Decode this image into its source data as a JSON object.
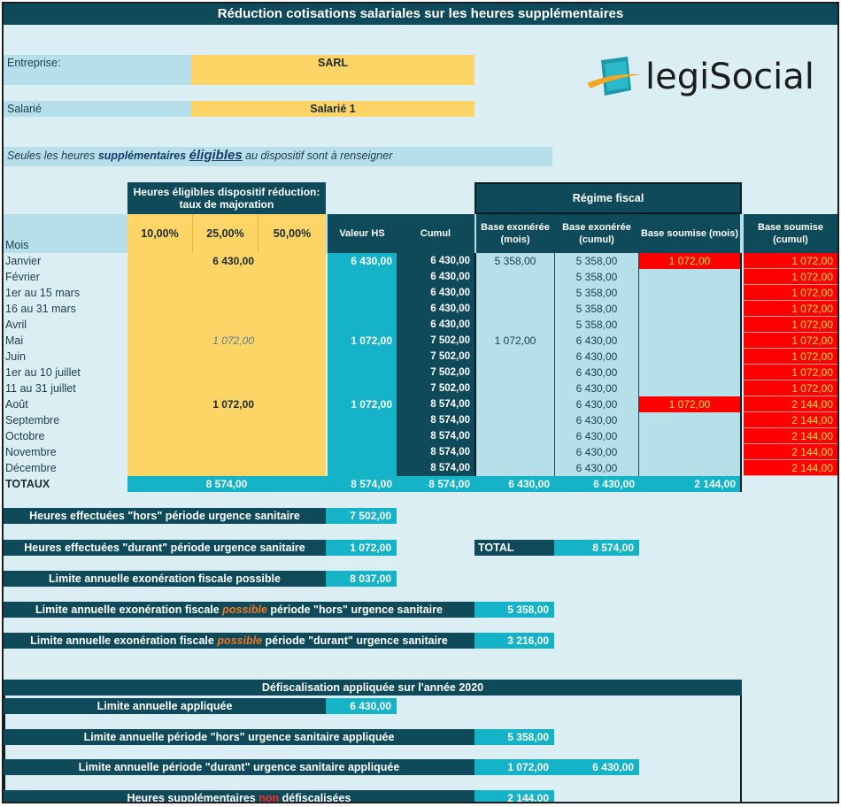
{
  "title": "Réduction cotisations salariales sur les heures supplémentaires",
  "logo": {
    "part1": "legi",
    "part2": "Social",
    "icon": "legisocial-logo-icon",
    "color_accent": "#f5a623",
    "color_main": "#1c1c1c",
    "color_cube": "#1a9aaa"
  },
  "entreprise": {
    "label": "Entreprise:",
    "value": "SARL"
  },
  "salarie": {
    "label": "Salarié",
    "value": "Salarié 1"
  },
  "note": {
    "part1": "Seules les heures ",
    "part2": "supplémentaires",
    "part3": "éligibles",
    "part4": " au dispositif sont à renseigner"
  },
  "table": {
    "group_header": "Heures éligibles dispositif réduction: taux de majoration",
    "rates": [
      "10,00%",
      "25,00%",
      "50,00%"
    ],
    "valeur_hs": "Valeur HS",
    "cumul": "Cumul",
    "regime_fiscal": "Régime fiscal",
    "base_exo_mois": "Base exonérée (mois)",
    "base_exo_cumul": "Base exonérée (cumul)",
    "base_soumise_mois": "Base soumise (mois)",
    "base_soumise_cumul": "Base soumise (cumul)",
    "mois_label": "Mois",
    "rows": [
      {
        "mois": "Janvier",
        "r25": "6 430,00",
        "r25_italic": false,
        "valeur": "6 430,00",
        "cumul": "6 430,00",
        "exo_mois": "5 358,00",
        "exo_cumul": "5 358,00",
        "soum_mois": "1 072,00",
        "soum_cumul": "1 072,00"
      },
      {
        "mois": "Février",
        "r25": "",
        "r25_italic": false,
        "valeur": "",
        "cumul": "6 430,00",
        "exo_mois": "",
        "exo_cumul": "5 358,00",
        "soum_mois": "",
        "soum_cumul": "1 072,00"
      },
      {
        "mois": "1er au 15 mars",
        "r25": "",
        "r25_italic": false,
        "valeur": "",
        "cumul": "6 430,00",
        "exo_mois": "",
        "exo_cumul": "5 358,00",
        "soum_mois": "",
        "soum_cumul": "1 072,00"
      },
      {
        "mois": "16 au 31 mars",
        "r25": "",
        "r25_italic": false,
        "valeur": "",
        "cumul": "6 430,00",
        "exo_mois": "",
        "exo_cumul": "5 358,00",
        "soum_mois": "",
        "soum_cumul": "1 072,00"
      },
      {
        "mois": "Avril",
        "r25": "",
        "r25_italic": false,
        "valeur": "",
        "cumul": "6 430,00",
        "exo_mois": "",
        "exo_cumul": "5 358,00",
        "soum_mois": "",
        "soum_cumul": "1 072,00"
      },
      {
        "mois": "Mai",
        "r25": "1 072,00",
        "r25_italic": true,
        "valeur": "1 072,00",
        "cumul": "7 502,00",
        "exo_mois": "1 072,00",
        "exo_cumul": "6 430,00",
        "soum_mois": "",
        "soum_cumul": "1 072,00"
      },
      {
        "mois": "Juin",
        "r25": "",
        "r25_italic": false,
        "valeur": "",
        "cumul": "7 502,00",
        "exo_mois": "",
        "exo_cumul": "6 430,00",
        "soum_mois": "",
        "soum_cumul": "1 072,00"
      },
      {
        "mois": "1er au 10 juillet",
        "r25": "",
        "r25_italic": false,
        "valeur": "",
        "cumul": "7 502,00",
        "exo_mois": "",
        "exo_cumul": "6 430,00",
        "soum_mois": "",
        "soum_cumul": "1 072,00"
      },
      {
        "mois": "11 au 31 juillet",
        "r25": "",
        "r25_italic": false,
        "valeur": "",
        "cumul": "7 502,00",
        "exo_mois": "",
        "exo_cumul": "6 430,00",
        "soum_mois": "",
        "soum_cumul": "1 072,00"
      },
      {
        "mois": "Août",
        "r25": "1 072,00",
        "r25_italic": false,
        "valeur": "1 072,00",
        "cumul": "8 574,00",
        "exo_mois": "",
        "exo_cumul": "6 430,00",
        "soum_mois": "1 072,00",
        "soum_cumul": "2 144,00"
      },
      {
        "mois": "Septembre",
        "r25": "",
        "r25_italic": false,
        "valeur": "",
        "cumul": "8 574,00",
        "exo_mois": "",
        "exo_cumul": "6 430,00",
        "soum_mois": "",
        "soum_cumul": "2 144,00"
      },
      {
        "mois": "Octobre",
        "r25": "",
        "r25_italic": false,
        "valeur": "",
        "cumul": "8 574,00",
        "exo_mois": "",
        "exo_cumul": "6 430,00",
        "soum_mois": "",
        "soum_cumul": "2 144,00"
      },
      {
        "mois": "Novembre",
        "r25": "",
        "r25_italic": false,
        "valeur": "",
        "cumul": "8 574,00",
        "exo_mois": "",
        "exo_cumul": "6 430,00",
        "soum_mois": "",
        "soum_cumul": "2 144,00"
      },
      {
        "mois": "Décembre",
        "r25": "",
        "r25_italic": false,
        "valeur": "",
        "cumul": "8 574,00",
        "exo_mois": "",
        "exo_cumul": "6 430,00",
        "soum_mois": "",
        "soum_cumul": "2 144,00"
      }
    ],
    "totaux": {
      "label": "TOTAUX",
      "r25": "8 574,00",
      "valeur": "8 574,00",
      "cumul": "8 574,00",
      "exo_mois": "6 430,00",
      "exo_cumul": "6 430,00",
      "soum_mois": "2 144,00"
    }
  },
  "summary": {
    "hors": {
      "label": "Heures effectuées \"hors\" période urgence sanitaire",
      "value": "7 502,00"
    },
    "durant": {
      "label": "Heures effectuées \"durant\" période urgence sanitaire",
      "value": "1 072,00"
    },
    "total": {
      "label": "TOTAL",
      "value": "8 574,00"
    },
    "limite": {
      "label": "Limite annuelle exonération fiscale possible",
      "value": "8 037,00"
    },
    "limite_hors": {
      "p1": "Limite annuelle exonération fiscale ",
      "p2": "possible",
      "p3": " période \"hors\" urgence sanitaire",
      "value": "5 358,00"
    },
    "limite_durant": {
      "p1": "Limite annuelle exonération fiscale ",
      "p2": "possible",
      "p3": " période \"durant\" urgence sanitaire",
      "value": "3 216,00"
    }
  },
  "defisc": {
    "title": "Défiscalisation appliquée sur l'année 2020",
    "appliquee": {
      "label": "Limite annuelle appliquée",
      "value": "6 430,00"
    },
    "hors": {
      "label": "Limite annuelle période \"hors\" urgence sanitaire appliquée",
      "value": "5 358,00"
    },
    "durant": {
      "label": "Limite annuelle période \"durant\" urgence sanitaire appliquée",
      "value": "1 072,00",
      "value2": "6 430,00"
    },
    "non": {
      "p1": "Heures supplémentaires ",
      "p2": "non",
      "p3": " défiscalisées",
      "value": "2 144,00"
    }
  }
}
